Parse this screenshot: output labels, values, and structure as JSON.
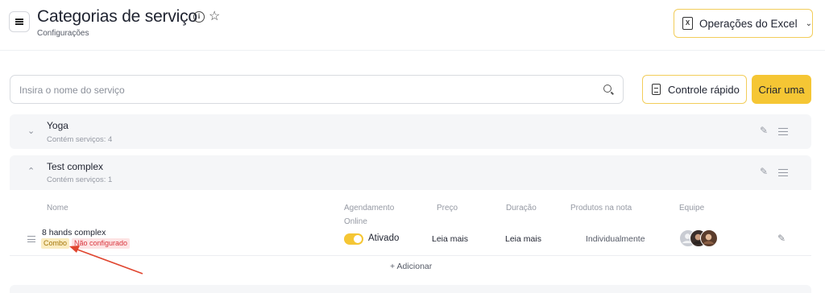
{
  "header": {
    "title": "Categorias de serviço",
    "subtitle": "Configurações",
    "excel_button": "Operações do Excel",
    "excel_icon_glyph": "X"
  },
  "toolbar": {
    "search_placeholder": "Insira o nome do serviço",
    "quick_control": "Controle rápido",
    "create": "Criar uma"
  },
  "categories": [
    {
      "name": "Yoga",
      "count": "Contém serviços: 4",
      "expanded": false
    },
    {
      "name": "Test complex",
      "count": "Contém serviços: 1",
      "expanded": true
    }
  ],
  "table": {
    "columns": [
      "Nome",
      "Agendamento Online",
      "Preço",
      "Duração",
      "Produtos na nota",
      "Equipe"
    ],
    "rows": [
      {
        "name": "8 hands complex",
        "badges": [
          "Combo",
          "Não configurado"
        ],
        "online": "Ativado",
        "online_enabled": true,
        "price": "Leia mais",
        "duration": "Leia mais",
        "products": "Individualmente",
        "team_count": 3
      }
    ],
    "add_label": "Adicionar"
  },
  "colors": {
    "accent": "#f5c634",
    "accent_border": "#f2cd5a",
    "error": "#d9363e",
    "combo_badge": "#fbecc1",
    "annotation_arrow": "#e0452f"
  }
}
